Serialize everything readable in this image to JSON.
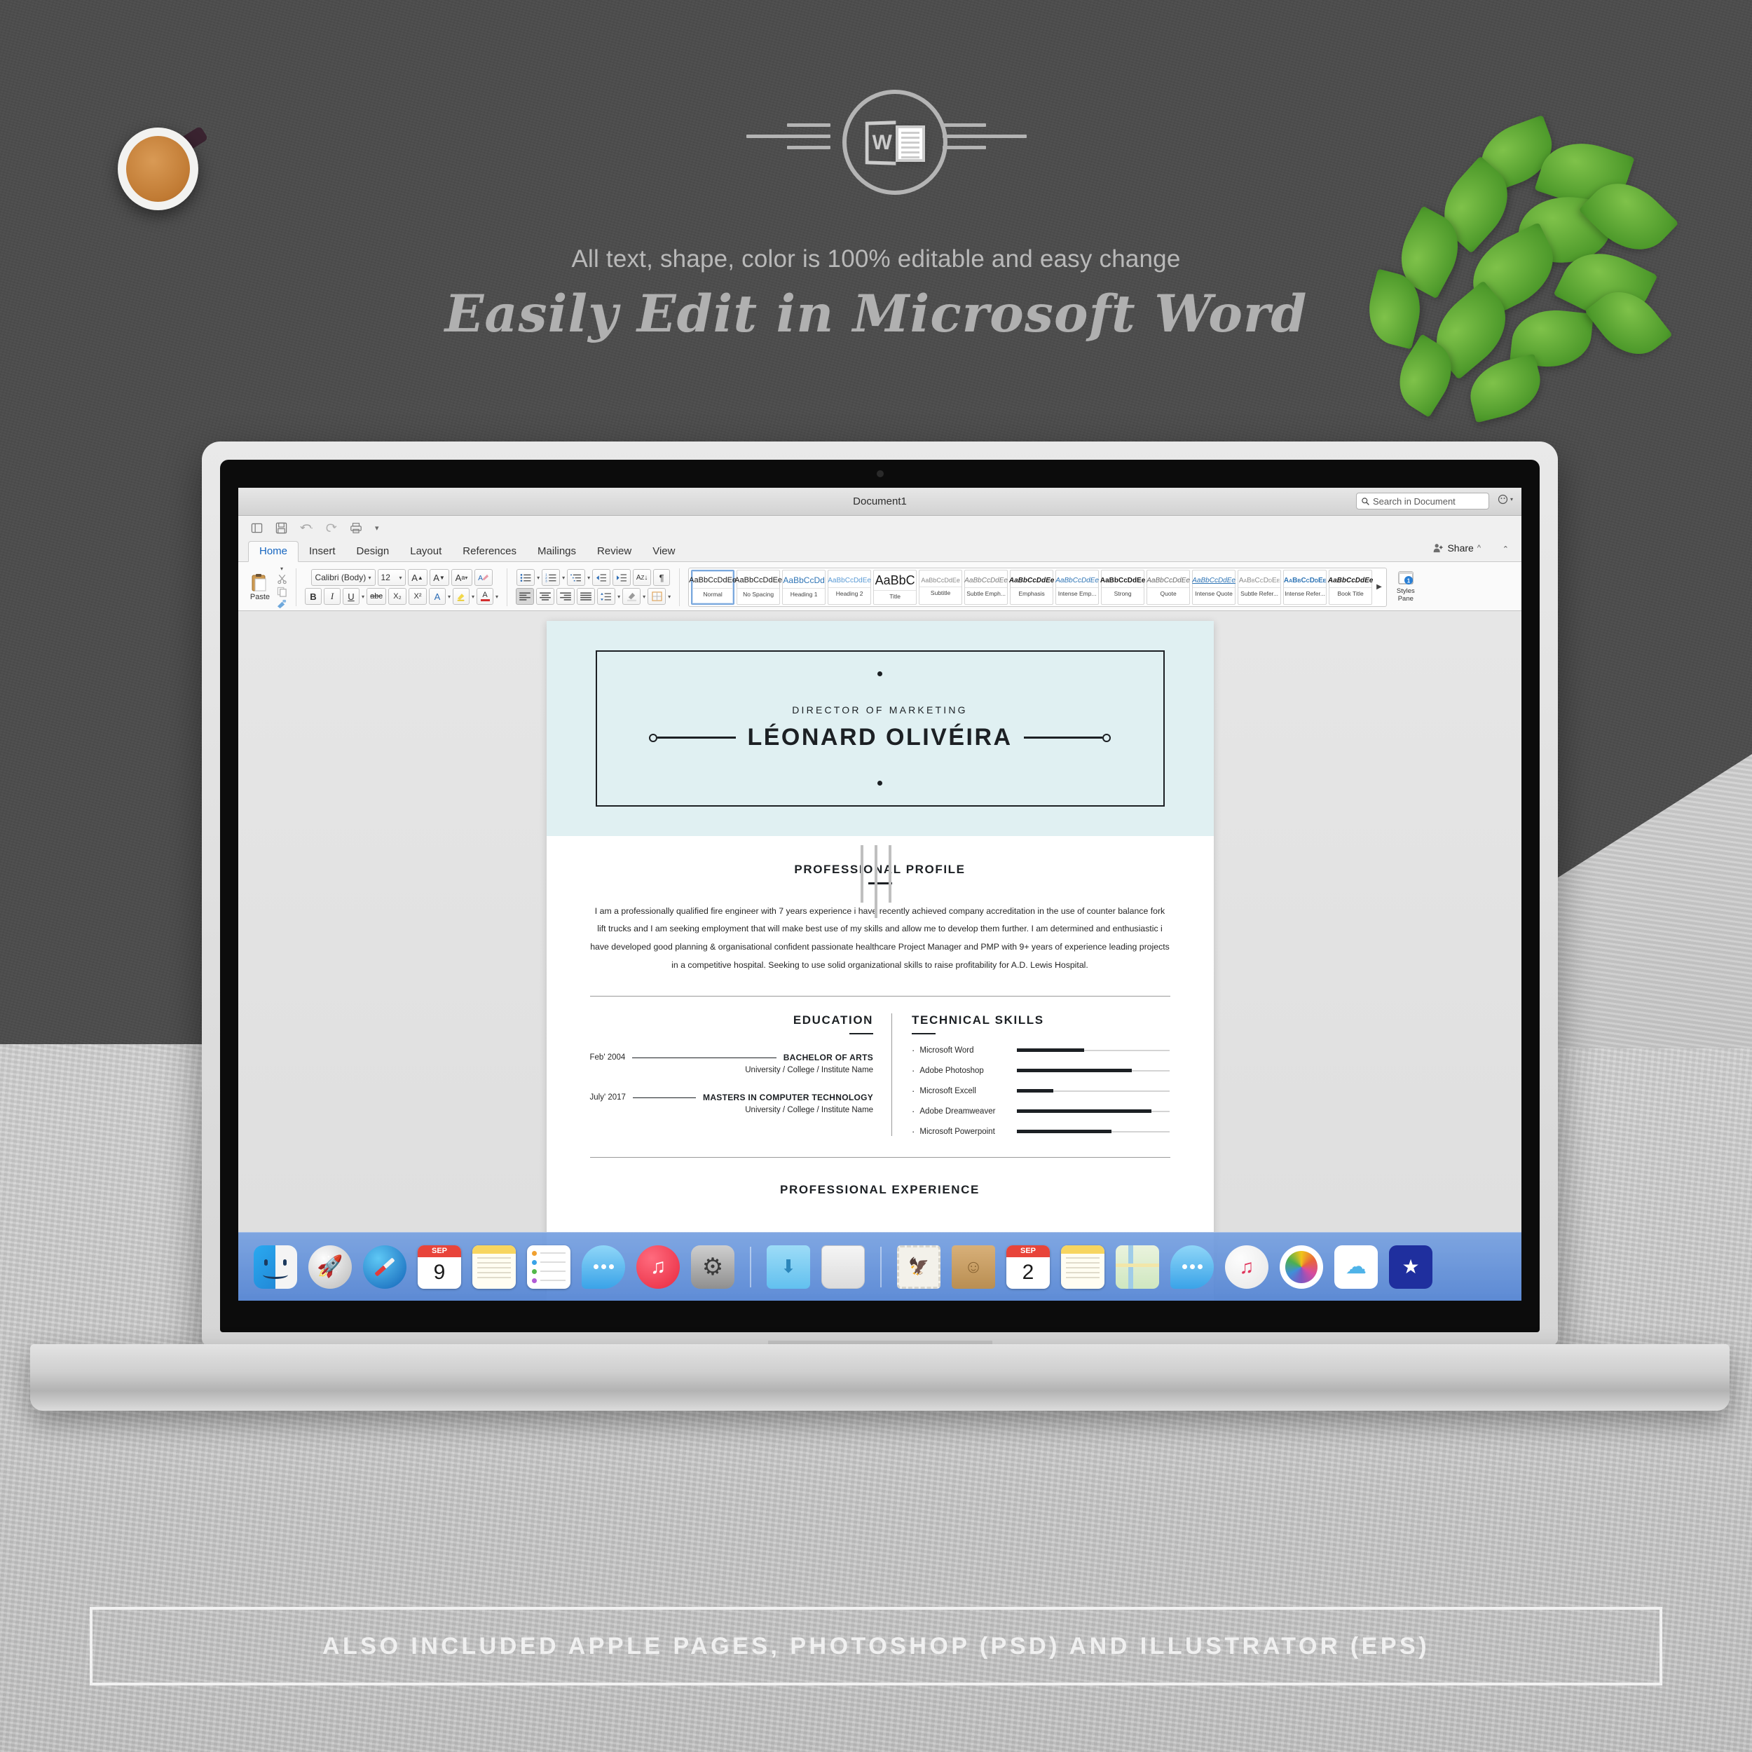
{
  "promo": {
    "tagline": "All text, shape, color is 100% editable and easy change",
    "headline": "Easily Edit in Microsoft Word",
    "emblem_letter": "W",
    "footer_banner": "ALSO INCLUDED APPLE PAGES, PHOTOSHOP (PSD) AND ILLUSTRATOR (EPS)"
  },
  "word": {
    "title": "Document1",
    "search_placeholder": "Search in Document",
    "share_label": "Share",
    "quick_access": [
      "sidebar-toggle-icon",
      "save-icon",
      "undo-icon",
      "redo-icon",
      "print-icon",
      "customize-qat-icon"
    ],
    "tabs": [
      {
        "label": "Home",
        "active": true
      },
      {
        "label": "Insert",
        "active": false
      },
      {
        "label": "Design",
        "active": false
      },
      {
        "label": "Layout",
        "active": false
      },
      {
        "label": "References",
        "active": false
      },
      {
        "label": "Mailings",
        "active": false
      },
      {
        "label": "Review",
        "active": false
      },
      {
        "label": "View",
        "active": false
      }
    ],
    "clipboard": {
      "paste_label": "Paste"
    },
    "font": {
      "name": "Calibri (Body)",
      "size": "12",
      "bold": "B",
      "italic": "I",
      "underline": "U",
      "strike": "abc",
      "subscript": "X₂",
      "superscript": "X²"
    },
    "styles_pane_label": "Styles\nPane",
    "styles_pane_line1": "Styles",
    "styles_pane_line2": "Pane",
    "styles": [
      {
        "sample": "AaBbCcDdEe",
        "name": "Normal",
        "selected": true
      },
      {
        "sample": "AaBbCcDdEe",
        "name": "No Spacing",
        "selected": false
      },
      {
        "sample": "AaBbCcDd",
        "name": "Heading 1",
        "selected": false
      },
      {
        "sample": "AaBbCcDdEe",
        "name": "Heading 2",
        "selected": false
      },
      {
        "sample": "AaBbC",
        "name": "Title",
        "selected": false
      },
      {
        "sample": "AaBbCcDdEe",
        "name": "Subtitle",
        "selected": false
      },
      {
        "sample": "AaBbCcDdEe",
        "name": "Subtle Emph...",
        "selected": false
      },
      {
        "sample": "AaBbCcDdEe",
        "name": "Emphasis",
        "selected": false
      },
      {
        "sample": "AaBbCcDdEe",
        "name": "Intense Emp...",
        "selected": false
      },
      {
        "sample": "AaBbCcDdEe",
        "name": "Strong",
        "selected": false
      },
      {
        "sample": "AaBbCcDdEe",
        "name": "Quote",
        "selected": false
      },
      {
        "sample": "AaBbCcDdEe",
        "name": "Intense Quote",
        "selected": false
      },
      {
        "sample": "AaBbCcDdEe",
        "name": "Subtle Refer...",
        "selected": false
      },
      {
        "sample": "AaBbCcDdEe",
        "name": "Intense Refer...",
        "selected": false
      },
      {
        "sample": "AaBbCcDdEe",
        "name": "Book Title",
        "selected": false
      }
    ],
    "styles_more": "▶"
  },
  "resume": {
    "job_title": "DIRECTOR OF MARKETING",
    "name": "LÉONARD OLIVÉIRA",
    "profile_heading": "PROFESSIONAL PROFILE",
    "profile_text": "I am a professionally qualified fire engineer with 7 years experience i have recently achieved company accreditation in the use of counter balance fork lift trucks and I am seeking employment that will make best use of my skills and allow me to develop them further. I am determined and enthusiastic i have developed good planning & organisational confident passionate healthcare Project Manager and PMP with 9+ years of experience leading projects in a competitive hospital. Seeking to use solid organizational skills to raise profitability for A.D. Lewis Hospital.",
    "education_heading": "EDUCATION",
    "education": [
      {
        "date": "Feb' 2004",
        "degree": "BACHELOR OF ARTS",
        "institute": "University / College / Institute Name"
      },
      {
        "date": "July' 2017",
        "degree": "MASTERS IN COMPUTER TECHNOLOGY",
        "institute": "University / College / Institute Name"
      }
    ],
    "skills_heading": "TECHNICAL SKILLS",
    "skills": [
      {
        "name": "Microsoft Word",
        "level": 44
      },
      {
        "name": "Adobe Photoshop",
        "level": 75
      },
      {
        "name": "Microsoft Excell",
        "level": 24
      },
      {
        "name": "Adobe Dreamweaver",
        "level": 88
      },
      {
        "name": "Microsoft Powerpoint",
        "level": 62
      }
    ],
    "experience_heading": "PROFESSIONAL EXPERIENCE",
    "accent_bg": "#e0f0f2",
    "ink": "#1c2024"
  },
  "dock": {
    "items": [
      {
        "icon": "finder-icon",
        "label": "Finder"
      },
      {
        "icon": "launchpad-icon",
        "label": "Launchpad"
      },
      {
        "icon": "safari-icon",
        "label": "Safari"
      },
      {
        "icon": "calendar-icon",
        "label": "Calendar",
        "month": "SEP",
        "day": "9"
      },
      {
        "icon": "notes-icon",
        "label": "Notes"
      },
      {
        "icon": "reminders-icon",
        "label": "Reminders"
      },
      {
        "icon": "messages-icon",
        "label": "Messages"
      },
      {
        "icon": "itunes-icon",
        "label": "iTunes"
      },
      {
        "icon": "system-preferences-icon",
        "label": "System Preferences"
      },
      {
        "icon": "downloads-folder-icon",
        "label": "Downloads"
      },
      {
        "icon": "trash-icon",
        "label": "Trash"
      },
      {
        "icon": "mail-icon",
        "label": "Mail"
      },
      {
        "icon": "contacts-icon",
        "label": "Contacts"
      },
      {
        "icon": "calendar-icon",
        "label": "Calendar",
        "month": "SEP",
        "day": "2"
      },
      {
        "icon": "notes-icon",
        "label": "Notes"
      },
      {
        "icon": "maps-icon",
        "label": "Maps"
      },
      {
        "icon": "messages-icon",
        "label": "Messages"
      },
      {
        "icon": "itunes-icon",
        "label": "iTunes"
      },
      {
        "icon": "photos-icon",
        "label": "Photos"
      },
      {
        "icon": "icloud-icon",
        "label": "iCloud Drive"
      },
      {
        "icon": "imovie-icon",
        "label": "iMovie"
      }
    ]
  }
}
